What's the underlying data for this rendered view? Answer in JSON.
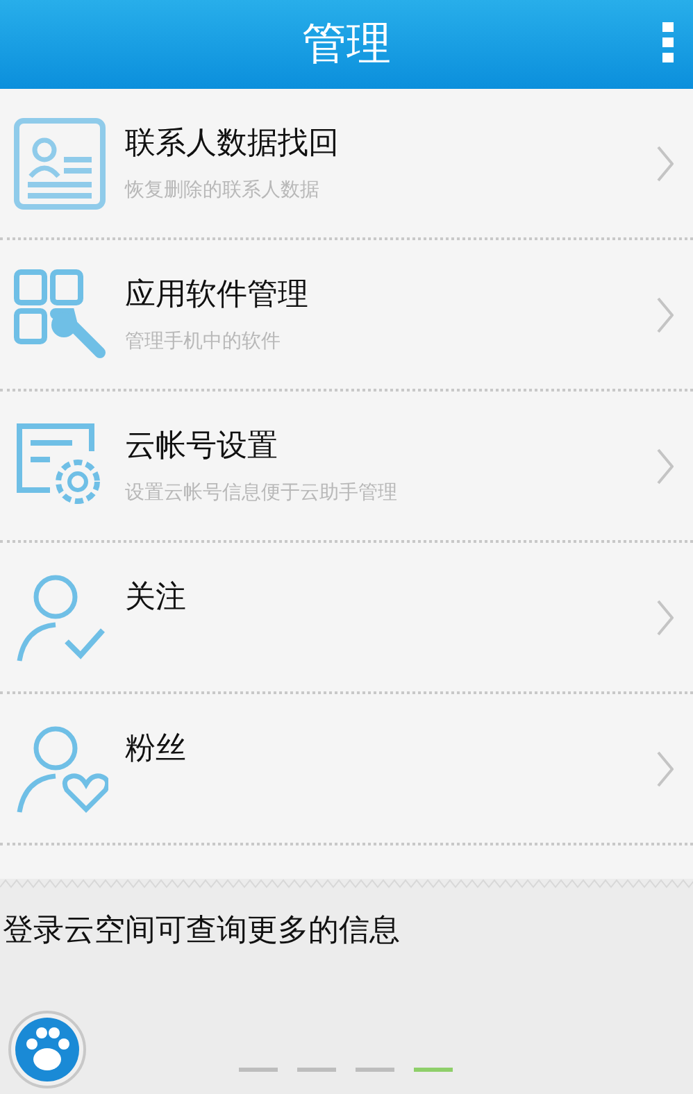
{
  "header": {
    "title": "管理"
  },
  "items": [
    {
      "kind": "contact-card",
      "title": "联系人数据找回",
      "subtitle": "恢复删除的联系人数据"
    },
    {
      "kind": "apps",
      "title": "应用软件管理",
      "subtitle": "管理手机中的软件"
    },
    {
      "kind": "account-settings",
      "title": "云帐号设置",
      "subtitle": "设置云帐号信息便于云助手管理"
    },
    {
      "kind": "follow",
      "title": "关注"
    },
    {
      "kind": "fans",
      "title": "粉丝"
    }
  ],
  "footer": {
    "message": "登录云空间可查询更多的信息"
  },
  "pages": [
    {
      "selected": false
    },
    {
      "selected": false
    },
    {
      "selected": false
    },
    {
      "selected": true
    }
  ]
}
